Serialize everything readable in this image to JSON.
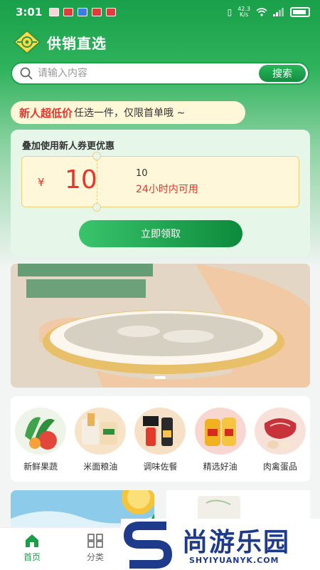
{
  "status_bar": {
    "time": "3:01",
    "net_speed": "42.3\nK/s",
    "icons": [
      "vibrate-icon",
      "wifi-icon",
      "signal-icon",
      "battery-icon"
    ]
  },
  "header": {
    "app_title": "供销直选",
    "logo_icon": "coop-logo-icon"
  },
  "search": {
    "placeholder": "请输入内容",
    "button_label": "搜索"
  },
  "promo": {
    "highlight": "新人超低价",
    "text": "任选一件，仅限首单哦 ~"
  },
  "coupon": {
    "title": "叠加使用新人券更优惠",
    "currency": "¥",
    "amount": "10",
    "value_text": "10",
    "validity": "24小时内可用",
    "claim_label": "立即领取"
  },
  "banner": {
    "image": "bird-nest-porridge-photo"
  },
  "categories": [
    {
      "label": "新鲜果蔬",
      "icon": "vegetables-icon"
    },
    {
      "label": "米面粮油",
      "icon": "grain-oil-icon"
    },
    {
      "label": "调味佐餐",
      "icon": "seasoning-icon"
    },
    {
      "label": "精选好油",
      "icon": "cooking-oil-icon"
    },
    {
      "label": "肉禽蛋品",
      "icon": "meat-eggs-icon"
    }
  ],
  "bottom_nav": [
    {
      "label": "首页",
      "icon": "home-icon",
      "active": true
    },
    {
      "label": "分类",
      "icon": "category-icon",
      "active": false
    }
  ],
  "watermark": {
    "title": "尚游乐园",
    "sub": "SHYIYUANYK.COM"
  },
  "colors": {
    "brand_green": "#1aa04a",
    "accent_red": "#e8352b",
    "coupon_bg": "#fff7d9"
  }
}
